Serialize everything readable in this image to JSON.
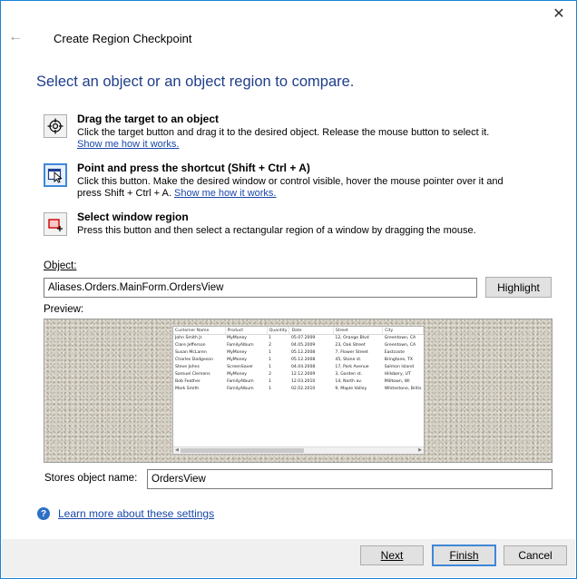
{
  "dialog": {
    "title": "Create Region Checkpoint",
    "close_glyph": "✕",
    "back_glyph": "←"
  },
  "heading": "Select an object or an object region to compare.",
  "options": [
    {
      "title": "Drag the target to an object",
      "description": "Click the target button and drag it to the desired object. Release the mouse button to select it.",
      "link": "Show me how it works.",
      "icon": "crosshair-target-icon"
    },
    {
      "title": "Point and press the shortcut (Shift + Ctrl + A)",
      "description": "Click this button. Make the desired window or control visible, hover the mouse pointer over it and press Shift + Ctrl + A.",
      "link": "Show me how it works.",
      "icon": "pointer-window-icon"
    },
    {
      "title": "Select window region",
      "description": "Press this button and then select a rectangular region of a window by dragging the mouse.",
      "icon": "region-select-icon"
    }
  ],
  "object": {
    "label": "Object:",
    "value": "Aliases.Orders.MainForm.OrdersView",
    "highlight_label": "Highlight"
  },
  "preview": {
    "label": "Preview:",
    "columns": [
      "Customer Name",
      "Product",
      "Quantity",
      "Date",
      "Street",
      "City"
    ],
    "rows": [
      [
        "John Smith Jr.",
        "MyMoney",
        "1",
        "05.07.2009",
        "12, Orange Blvd",
        "Greentown, CA"
      ],
      [
        "Clare Jefferson",
        "FamilyAlbum",
        "2",
        "04.05.2009",
        "23, Oak Street",
        "Greentown, CA"
      ],
      [
        "Susan McLaren",
        "MyMoney",
        "1",
        "05.12.2008",
        "7, Flower Street",
        "Eastcoste"
      ],
      [
        "Charles Dodgeson",
        "MyMoney",
        "1",
        "05.12.2008",
        "45, Stone st.",
        "Bringtone, TX"
      ],
      [
        "Steve Johns",
        "ScreenSaver",
        "1",
        "04.04.2008",
        "17, Park Avenue",
        "Salmon Island"
      ],
      [
        "Samuel Clemens",
        "MyMoney",
        "2",
        "12.12.2009",
        "3, Garden st.",
        "Hillsbery, UT"
      ],
      [
        "Bob Feather",
        "FamilyAlbum",
        "1",
        "12.03.2010",
        "14, North av.",
        "Milltown, WI"
      ],
      [
        "Mark Smith",
        "FamilyAlbum",
        "1",
        "02.02.2010",
        "9, Maple Valley",
        "Whitestone, Britis"
      ]
    ]
  },
  "stores": {
    "label": "Stores object name:",
    "value": "OrdersView"
  },
  "help": {
    "icon": "help-icon",
    "glyph": "?",
    "link": "Learn more about these settings"
  },
  "footer": {
    "next_label": "Next",
    "finish_label": "Finish",
    "cancel_label": "Cancel"
  },
  "colors": {
    "heading": "#1f3e8a",
    "link": "#1a47a8",
    "accent": "#3f87d8",
    "window_border": "#1883d7"
  }
}
